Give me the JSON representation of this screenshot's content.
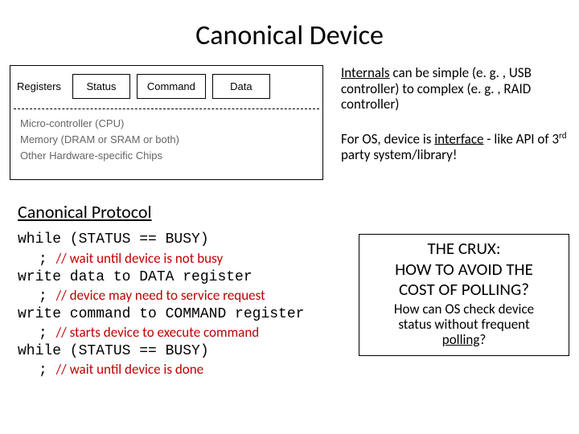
{
  "title": "Canonical Device",
  "diagram": {
    "registers_label": "Registers",
    "boxes": [
      "Status",
      "Command",
      "Data"
    ],
    "bottom_lines": [
      "Micro-controller (CPU)",
      "Memory (DRAM or SRAM or both)",
      "Other Hardware-specific Chips"
    ]
  },
  "notes": {
    "p1_pre": "Internals",
    "p1_rest": " can be simple (e. g. , USB controller) to complex (e. g. , RAID controller)",
    "p2_a": "For OS, device is ",
    "p2_b": "interface",
    "p2_c": " - like API of 3",
    "p2_sup": "rd",
    "p2_d": " party system/library!"
  },
  "protocol": {
    "header": "Canonical Protocol",
    "l1": "while (STATUS == BUSY)",
    "n1": "// wait until device is not busy",
    "l2": "write data to DATA register",
    "n2": "// device may need to service request",
    "l3": "write command to COMMAND register",
    "n3": "// starts device to execute command",
    "l4": "while (STATUS == BUSY)",
    "n4": "// wait until device is done",
    "semi": "; "
  },
  "crux": {
    "t1": "THE CRUX:",
    "t2": "HOW TO AVOID THE",
    "t3": "COST OF POLLING?",
    "b1": "How can OS check device",
    "b2": "status without frequent",
    "b3": "polling",
    "b4": "?"
  }
}
